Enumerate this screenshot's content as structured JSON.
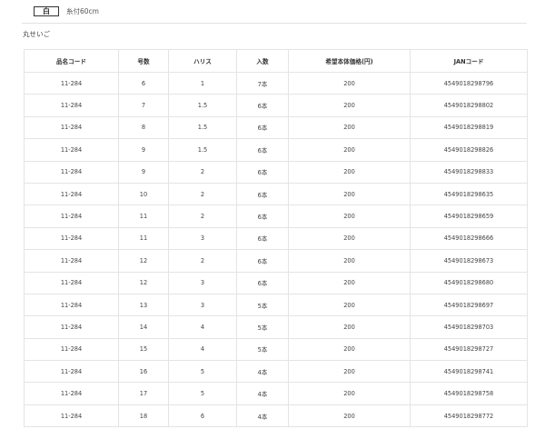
{
  "header": {
    "color_label": "白",
    "length_text": "糸付60cm"
  },
  "section": {
    "title": "丸せいご"
  },
  "table": {
    "columns": [
      "品名コード",
      "号数",
      "ハリス",
      "入数",
      "希望本体価格(円)",
      "JANコード"
    ],
    "rows": [
      [
        "11-284",
        "6",
        "1",
        "7本",
        "200",
        "4549018298796"
      ],
      [
        "11-284",
        "7",
        "1.5",
        "6本",
        "200",
        "4549018298802"
      ],
      [
        "11-284",
        "8",
        "1.5",
        "6本",
        "200",
        "4549018298819"
      ],
      [
        "11-284",
        "9",
        "1.5",
        "6本",
        "200",
        "4549018298826"
      ],
      [
        "11-284",
        "9",
        "2",
        "6本",
        "200",
        "4549018298833"
      ],
      [
        "11-284",
        "10",
        "2",
        "6本",
        "200",
        "4549018298635"
      ],
      [
        "11-284",
        "11",
        "2",
        "6本",
        "200",
        "4549018298659"
      ],
      [
        "11-284",
        "11",
        "3",
        "6本",
        "200",
        "4549018298666"
      ],
      [
        "11-284",
        "12",
        "2",
        "6本",
        "200",
        "4549018298673"
      ],
      [
        "11-284",
        "12",
        "3",
        "6本",
        "200",
        "4549018298680"
      ],
      [
        "11-284",
        "13",
        "3",
        "5本",
        "200",
        "4549018298697"
      ],
      [
        "11-284",
        "14",
        "4",
        "5本",
        "200",
        "4549018298703"
      ],
      [
        "11-284",
        "15",
        "4",
        "5本",
        "200",
        "4549018298727"
      ],
      [
        "11-284",
        "16",
        "5",
        "4本",
        "200",
        "4549018298741"
      ],
      [
        "11-284",
        "17",
        "5",
        "4本",
        "200",
        "4549018298758"
      ],
      [
        "11-284",
        "18",
        "6",
        "4本",
        "200",
        "4549018298772"
      ]
    ]
  }
}
